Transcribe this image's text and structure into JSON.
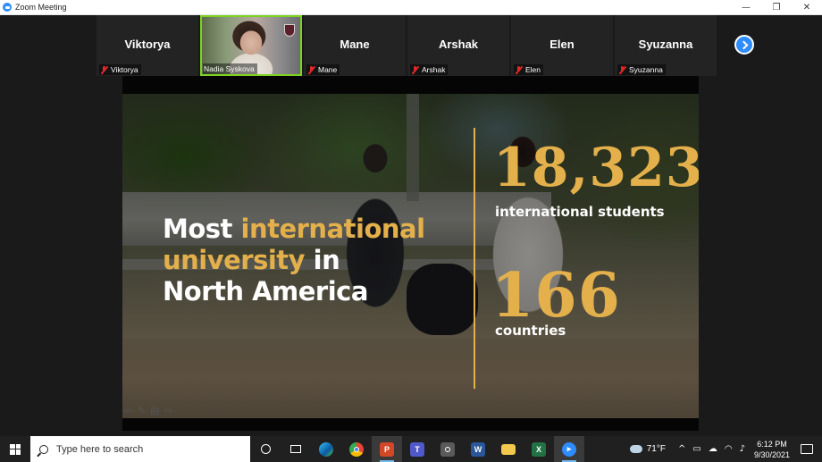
{
  "window": {
    "title": "Zoom Meeting",
    "minimize": "—",
    "restore": "❐",
    "close": "✕"
  },
  "participants": [
    {
      "display_name": "Viktorya",
      "label": "Viktorya",
      "video": false,
      "muted": true
    },
    {
      "display_name": "",
      "label": "Nadia Syskova",
      "video": true,
      "muted": false
    },
    {
      "display_name": "Mane",
      "label": "Mane",
      "video": false,
      "muted": true
    },
    {
      "display_name": "Arshak",
      "label": "Arshak",
      "video": false,
      "muted": true
    },
    {
      "display_name": "Elen",
      "label": "Elen",
      "video": false,
      "muted": true
    },
    {
      "display_name": "Syuzanna",
      "label": "Syuzanna",
      "video": false,
      "muted": true
    }
  ],
  "slide": {
    "headline_line1_white": "Most ",
    "headline_line1_accent": "international",
    "headline_line2_accent": "university",
    "headline_line2_white": " in",
    "headline_line3": "North America",
    "stat1_value": "18,323",
    "stat1_label": "international students",
    "stat2_value": "166",
    "stat2_label": "countries",
    "accent_color": "#e3b04b",
    "tools": [
      "prev-arrow-icon",
      "pen-icon",
      "menu-icon",
      "next-arrow-icon"
    ]
  },
  "taskbar": {
    "search_placeholder": "Type here to search",
    "apps": [
      "task-view",
      "edge",
      "chrome",
      "powerpoint",
      "teams",
      "camera",
      "word",
      "file-explorer",
      "excel",
      "zoom"
    ],
    "weather": "71°F",
    "time": "6:12 PM",
    "date": "9/30/2021"
  },
  "colors": {
    "zoom_blue": "#2d8cff",
    "active_speaker": "#7ed321",
    "mute_red": "#e02828"
  }
}
